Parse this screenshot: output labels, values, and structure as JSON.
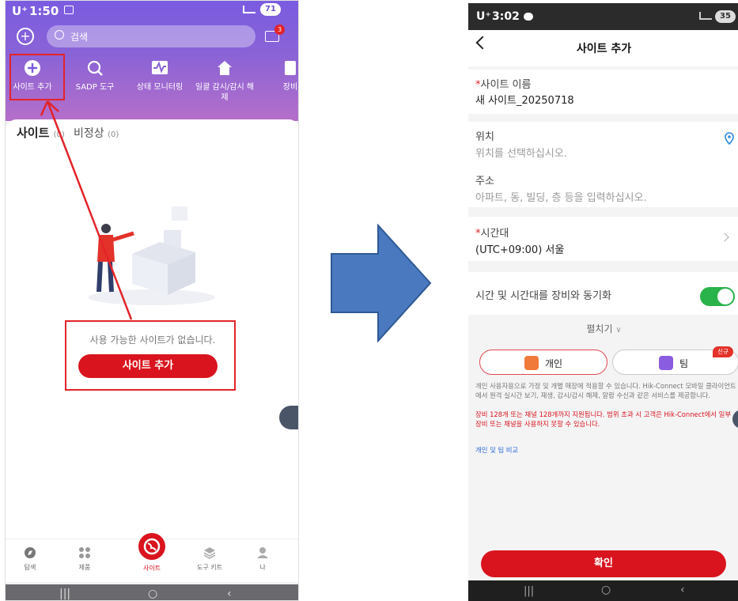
{
  "left": {
    "status": {
      "carrier": "U⁺",
      "time": "1:50",
      "battery": "71"
    },
    "search": {
      "placeholder": "검색"
    },
    "mail_badge": "3",
    "quick_actions": [
      {
        "label": "사이트 추가",
        "icon": "plus-circle-icon"
      },
      {
        "label": "SADP 도구",
        "icon": "search-gear-icon"
      },
      {
        "label": "상태 모니터링",
        "icon": "pulse-icon"
      },
      {
        "label": "일괄 감시/감시 해제",
        "icon": "home-shield-icon"
      },
      {
        "label": "장비",
        "icon": "device-icon"
      }
    ],
    "tabs": [
      {
        "label": "사이트",
        "count": "(0)"
      },
      {
        "label": "비정상",
        "count": "(0)"
      }
    ],
    "empty_message": "사용 가능한 사이트가 없습니다.",
    "add_site_button": "사이트 추가",
    "nav": [
      {
        "label": "탐색",
        "icon": "compass-icon"
      },
      {
        "label": "제품",
        "icon": "grid-icon"
      },
      {
        "label": "사이트",
        "icon": "globe-icon"
      },
      {
        "label": "도구 키트",
        "icon": "layers-icon"
      },
      {
        "label": "나",
        "icon": "user-icon"
      }
    ],
    "sys_nav": [
      "|||",
      "○",
      "‹"
    ]
  },
  "right": {
    "status": {
      "carrier": "U⁺",
      "time": "3:02",
      "battery": "35"
    },
    "title": "사이트 추가",
    "site_name": {
      "required": "*",
      "label": "사이트 이름",
      "value": "새 사이트_20250718"
    },
    "location": {
      "label": "위치",
      "placeholder": "위치를 선택하십시오."
    },
    "address": {
      "label": "주소",
      "placeholder": "아파트, 동, 빌딩, 층 등을 입력하십시오."
    },
    "timezone": {
      "required": "*",
      "label": "시간대",
      "value": "(UTC+09:00) 서울"
    },
    "sync": {
      "label": "시간 및 시간대를 장비와 동기화",
      "on": true
    },
    "expand": "펼치기",
    "plans": [
      {
        "label": "개인",
        "selected": true
      },
      {
        "label": "팀",
        "selected": false,
        "badge": "신규"
      }
    ],
    "description": "개인 사용자용으로 가정 및 개별 매장에 적용할 수 있습니다. Hik-Connect 모바일 클라이언트에서 원격 실시간 보기, 재생, 감시/감시 해제, 알람 수신과 같은 서비스를 제공합니다.",
    "warning": "장비 128개 또는 채널 128개까지 지원됩니다. 범위 초과 시 고객은 Hik-Connect에서 일부 장비 또는 채널을 사용하지 못할 수 있습니다.",
    "compare_link": "개인 및 팀 비교",
    "confirm_button": "확인",
    "sys_nav": [
      "|||",
      "○",
      "‹"
    ]
  },
  "colors": {
    "accent_red": "#d9141e",
    "header_purple": "#7a5ce0",
    "toggle_green": "#2ab24b",
    "arrow_blue": "#4a79c0"
  }
}
